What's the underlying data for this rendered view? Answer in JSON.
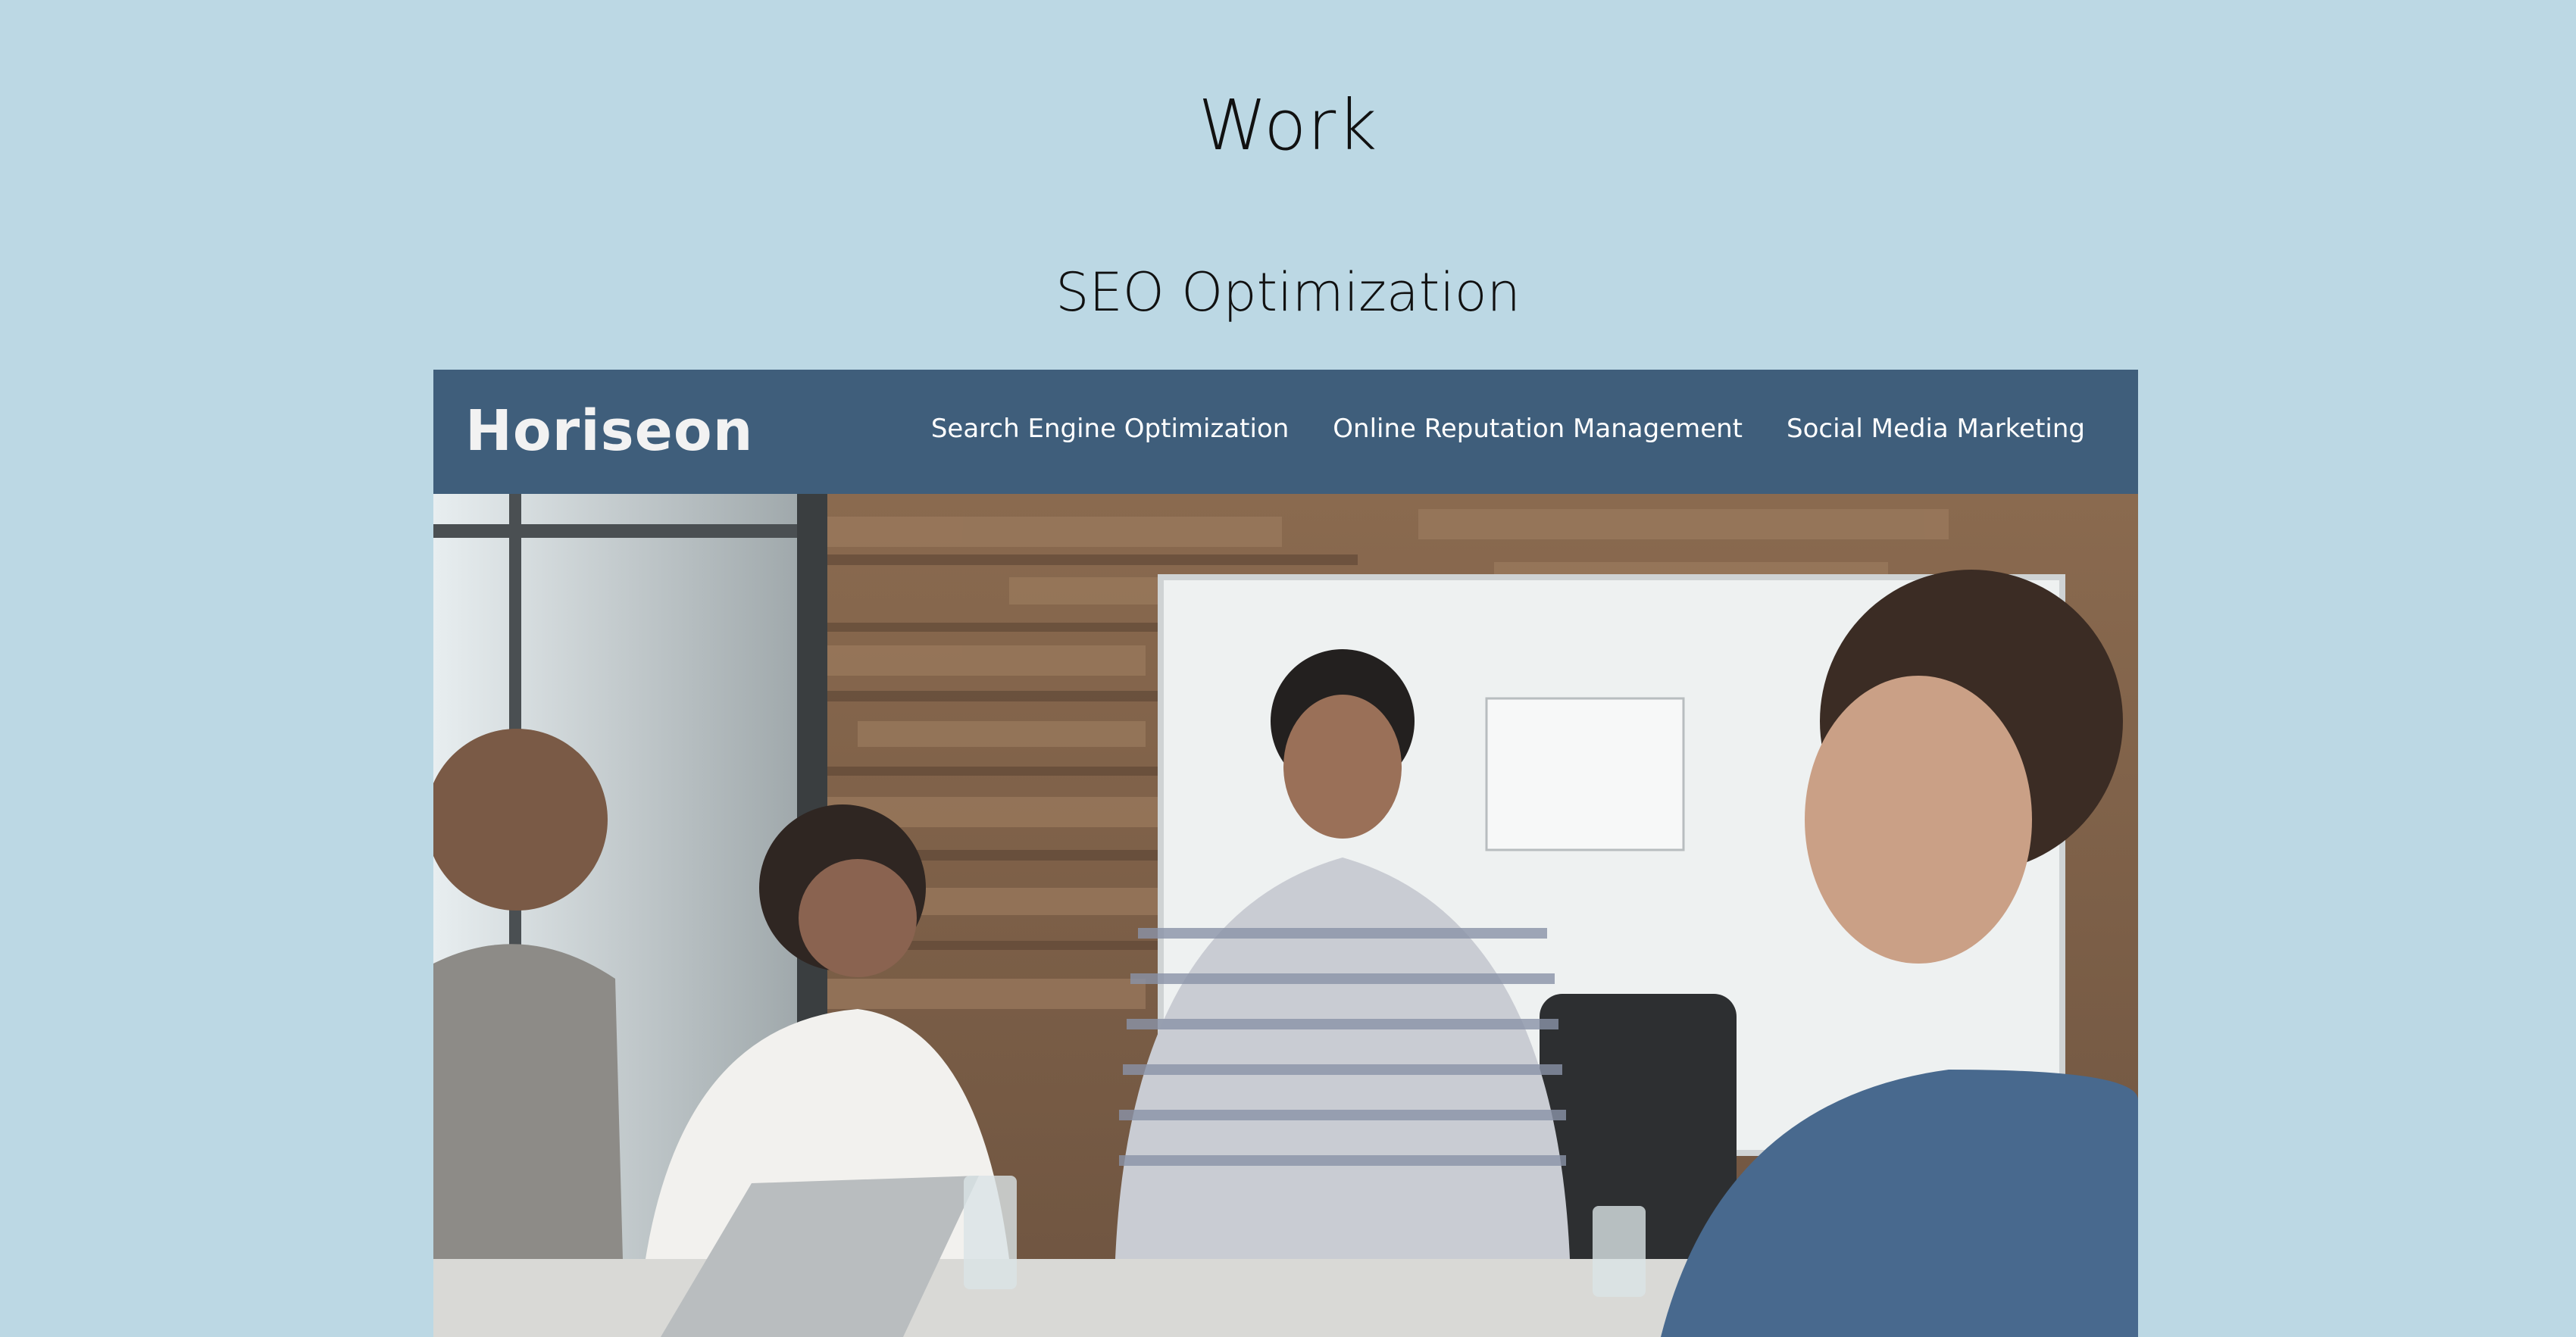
{
  "section": {
    "title": "Work"
  },
  "project": {
    "title": "SEO Optimization",
    "preview": {
      "logo": "Horiseon",
      "nav": [
        "Search Engine Optimization",
        "Online Reputation Management",
        "Social Media Marketing"
      ],
      "colors": {
        "header": "#3f5e7b",
        "page_background": "#bcd8e4"
      }
    }
  }
}
